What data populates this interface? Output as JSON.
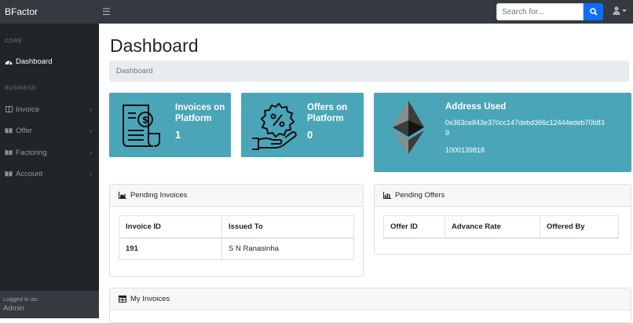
{
  "app": {
    "brand": "BFactor"
  },
  "topbar": {
    "search_placeholder": "Search for...",
    "icons": {
      "menu": "hamburger-icon",
      "search": "search-icon",
      "user": "user-icon",
      "caret": "caret-down-icon"
    }
  },
  "sidebar": {
    "core_heading": "CORE",
    "dashboard": "Dashboard",
    "business_heading": "BUSINESS",
    "items": [
      {
        "label": "Invoice",
        "icon": "columns-icon"
      },
      {
        "label": "Offer",
        "icon": "book-open-icon"
      },
      {
        "label": "Factoring",
        "icon": "book-open-icon"
      },
      {
        "label": "Account",
        "icon": "book-open-icon"
      }
    ],
    "footer_small": "Logged in as:",
    "footer_name": "Admin"
  },
  "main": {
    "title": "Dashboard",
    "breadcrumb": "Dashboard",
    "cards": {
      "invoices": {
        "title_line1": "Invoices on",
        "title_line2": "Platform",
        "value": "1",
        "icon": "invoice-dollar-icon"
      },
      "offers": {
        "title_line1": "Offers on",
        "title_line2": "Platform",
        "value": "0",
        "icon": "discount-hand-icon"
      },
      "address": {
        "title": "Address Used",
        "address_line1": "0x363ce843e370cc147debd366c12444edeb70b83",
        "address_line2": "9",
        "balance": "1000139818",
        "icon": "ethereum-icon"
      }
    },
    "pending_invoices": {
      "title": "Pending Invoices",
      "columns": [
        "Invoice ID",
        "Issued To"
      ],
      "rows": [
        {
          "id": "191",
          "issued_to": "S N Ranasinha"
        }
      ]
    },
    "pending_offers": {
      "title": "Pending Offers",
      "columns": [
        "Offer ID",
        "Advance Rate",
        "Offered By"
      ]
    },
    "my_invoices": {
      "title": "My Invoices"
    }
  },
  "colors": {
    "card": "#4ba5b8",
    "navbar": "#343a40",
    "sidebar": "#212529",
    "search_button": "#0d6efd"
  }
}
